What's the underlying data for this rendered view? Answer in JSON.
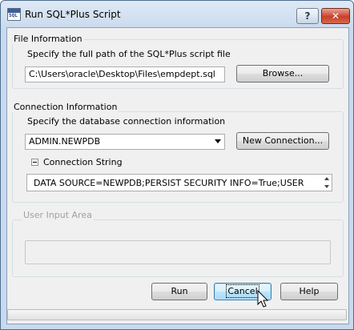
{
  "window": {
    "title": "Run SQL*Plus Script",
    "app_icon_text": "SQL",
    "help_button": "?",
    "close_button": "✕"
  },
  "file_info": {
    "group_label": "File Information",
    "instruction": "Specify the full path of the SQL*Plus script file",
    "path_value": "C:\\Users\\oracle\\Desktop\\Files\\empdept.sql",
    "browse_label": "Browse..."
  },
  "connection_info": {
    "group_label": "Connection Information",
    "instruction": "Specify the database connection information",
    "selected_connection": "ADMIN.NEWPDB",
    "new_connection_label": "New Connection...",
    "connection_string_label": "Connection String",
    "connection_string_value": "DATA SOURCE=NEWPDB;PERSIST SECURITY INFO=True;USER"
  },
  "user_input": {
    "group_label": "User Input Area"
  },
  "buttons": {
    "run": "Run",
    "cancel": "Cancel",
    "help": "Help"
  }
}
